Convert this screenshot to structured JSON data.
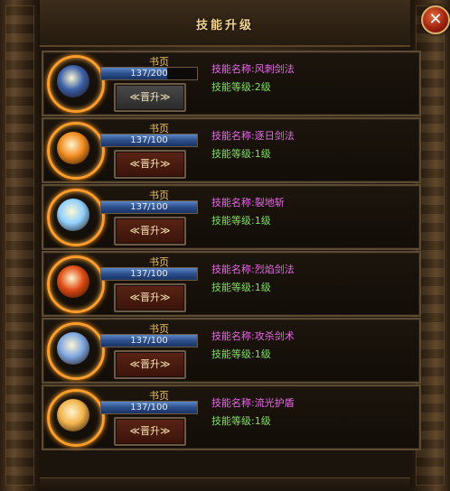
{
  "window": {
    "title": "技能升级",
    "close_label": "✕"
  },
  "skills": [
    {
      "book_label": "书页",
      "progress_text": "137/200",
      "progress": 0.685,
      "button_label": "≪晋升≫",
      "button_state": "gray",
      "name_prefix": "技能名称:",
      "name": "风刺剑法",
      "level_prefix": "技能等级:",
      "level": "2级",
      "icon": "wind-sword-icon",
      "color": "#3a5fa8"
    },
    {
      "book_label": "书页",
      "progress_text": "137/100",
      "progress": 1,
      "button_label": "≪晋升≫",
      "button_state": "red",
      "name_prefix": "技能名称:",
      "name": "逐日剑法",
      "level_prefix": "技能等级:",
      "level": "1级",
      "icon": "sun-sword-icon",
      "color": "#f08a1c"
    },
    {
      "book_label": "书页",
      "progress_text": "137/100",
      "progress": 1,
      "button_label": "≪晋升≫",
      "button_state": "red",
      "name_prefix": "技能名称:",
      "name": "裂地斩",
      "level_prefix": "技能等级:",
      "level": "1级",
      "icon": "earth-split-icon",
      "color": "#8fd0ff"
    },
    {
      "book_label": "书页",
      "progress_text": "137/100",
      "progress": 1,
      "button_label": "≪晋升≫",
      "button_state": "red",
      "name_prefix": "技能名称:",
      "name": "烈焰剑法",
      "level_prefix": "技能等级:",
      "level": "1级",
      "icon": "flame-sword-icon",
      "color": "#e04a12"
    },
    {
      "book_label": "书页",
      "progress_text": "137/100",
      "progress": 1,
      "button_label": "≪晋升≫",
      "button_state": "red",
      "name_prefix": "技能名称:",
      "name": "攻杀剑术",
      "level_prefix": "技能等级:",
      "level": "1级",
      "icon": "attack-sword-icon",
      "color": "#7ea6e0"
    },
    {
      "book_label": "书页",
      "progress_text": "137/100",
      "progress": 1,
      "button_label": "≪晋升≫",
      "button_state": "red",
      "name_prefix": "技能名称:",
      "name": "流光护盾",
      "level_prefix": "技能等级:",
      "level": "1级",
      "icon": "shield-icon",
      "color": "#f2b34a"
    }
  ]
}
